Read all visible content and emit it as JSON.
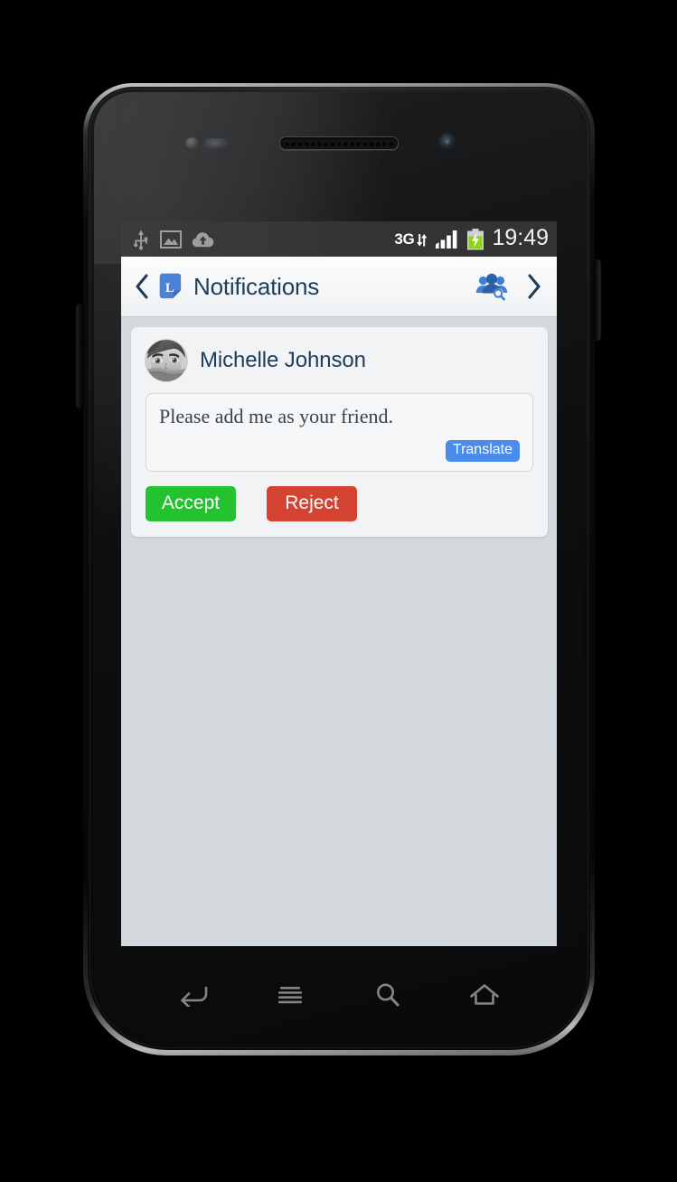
{
  "status_bar": {
    "icons_left": [
      "usb-icon",
      "screenshot-image-icon",
      "cloud-upload-icon"
    ],
    "network_type": "3G",
    "signal_icon": "signal-bars-icon",
    "battery_icon": "battery-charging-icon",
    "clock": "19:49"
  },
  "action_bar": {
    "back_icon": "chevron-left-icon",
    "app_logo": "app-logo-l",
    "app_logo_letter": "L",
    "title": "Notifications",
    "find_friends_icon": "find-friends-icon",
    "next_icon": "chevron-right-icon"
  },
  "notification": {
    "avatar": "user-avatar-photo",
    "sender": "Michelle Johnson",
    "message": "Please add me as your friend.",
    "translate_label": "Translate",
    "accept_label": "Accept",
    "reject_label": "Reject"
  },
  "nav_bar": {
    "back": "back-icon",
    "menu": "menu-icon",
    "search": "search-icon",
    "home": "home-icon"
  },
  "colors": {
    "accent_blue": "#4a8cec",
    "title_navy": "#1c3d5e",
    "accept_green": "#22c32e",
    "reject_red": "#d44332",
    "screen_bg": "#d3d9dd",
    "card_bg": "#f1f3f4",
    "status_bar_bg": "#333333"
  }
}
